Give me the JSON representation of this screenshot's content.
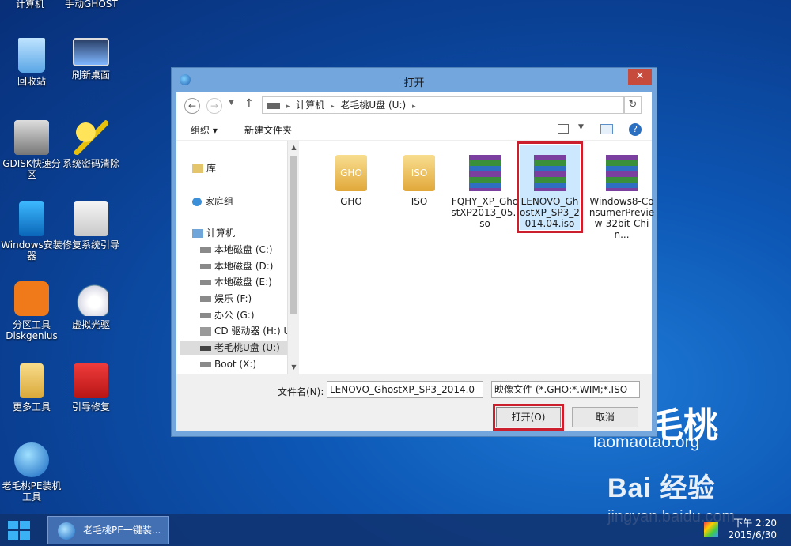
{
  "desktop": {
    "top_labels": [
      "计算机",
      "手动GHOST"
    ],
    "icons": [
      {
        "label": "回收站",
        "icon": "recycle-bin-icon"
      },
      {
        "label": "刷新桌面",
        "icon": "refresh-desktop-icon"
      },
      {
        "label": "GDISK快速分区",
        "icon": "gdisk-icon"
      },
      {
        "label": "系统密码清除",
        "icon": "key-icon"
      },
      {
        "label": "Windows安装器",
        "icon": "windows-installer-icon"
      },
      {
        "label": "修复系统引导",
        "icon": "first-aid-kit-icon"
      },
      {
        "label": "分区工具Diskgenius",
        "icon": "diskgenius-icon"
      },
      {
        "label": "虚拟光驱",
        "icon": "virtual-drive-icon"
      },
      {
        "label": "更多工具",
        "icon": "folder-icon"
      },
      {
        "label": "引导修复",
        "icon": "toolbox-icon"
      },
      {
        "label": "老毛桃PE装机工具",
        "icon": "laomaotao-peach-icon"
      }
    ],
    "wallpaper_logo": {
      "big": "毛桃",
      "small": "laomaotao.org"
    },
    "watermark": {
      "brand": "Bai 经验",
      "url": "jingyan.baidu.com"
    }
  },
  "dialog": {
    "title": "打开",
    "close_label": "✕",
    "nav": {
      "back": "←",
      "forward": "→",
      "up": "↑",
      "refresh": "↻"
    },
    "address": {
      "parts": [
        "计算机",
        "老毛桃U盘 (U:)"
      ],
      "separator": "▸"
    },
    "toolbar": {
      "organize": "组织 ▾",
      "new_folder": "新建文件夹",
      "help": "?"
    },
    "nav_pane": [
      {
        "label": "库",
        "icon": "library-icon"
      },
      {
        "label": "家庭组",
        "icon": "homegroup-icon"
      },
      {
        "label": "计算机",
        "icon": "computer-icon"
      },
      {
        "label": "本地磁盘 (C:)",
        "icon": "drive-icon"
      },
      {
        "label": "本地磁盘 (D:)",
        "icon": "drive-icon"
      },
      {
        "label": "本地磁盘 (E:)",
        "icon": "drive-icon"
      },
      {
        "label": "娱乐 (F:)",
        "icon": "drive-icon"
      },
      {
        "label": "办公 (G:)",
        "icon": "drive-icon"
      },
      {
        "label": "CD 驱动器 (H:) U",
        "icon": "cd-drive-icon"
      },
      {
        "label": "老毛桃U盘 (U:)",
        "icon": "usb-drive-icon",
        "selected": true
      },
      {
        "label": "Boot (X:)",
        "icon": "drive-icon"
      }
    ],
    "files": [
      {
        "name": "GHO",
        "icon": "folder-icon",
        "badge": "GHO"
      },
      {
        "name": "ISO",
        "icon": "folder-icon",
        "badge": "ISO"
      },
      {
        "name": "FQHY_XP_GhostXP2013_05.iso",
        "icon": "winrar-archive-icon"
      },
      {
        "name": "LENOVO_GhostXP_SP3_2014.04.iso",
        "icon": "winrar-archive-icon",
        "selected": true
      },
      {
        "name": "Windows8-ConsumerPreview-32bit-Chin...",
        "icon": "winrar-archive-icon"
      }
    ],
    "file_name_label": "文件名(N):",
    "file_name_value": "LENOVO_GhostXP_SP3_2014.0",
    "file_type_value": "映像文件 (*.GHO;*.WIM;*.ISO",
    "open_label": "打开(O)",
    "cancel_label": "取消"
  },
  "taskbar": {
    "task_label": "老毛桃PE一键装...",
    "time": "下午 2:20",
    "date": "2015/6/30"
  }
}
